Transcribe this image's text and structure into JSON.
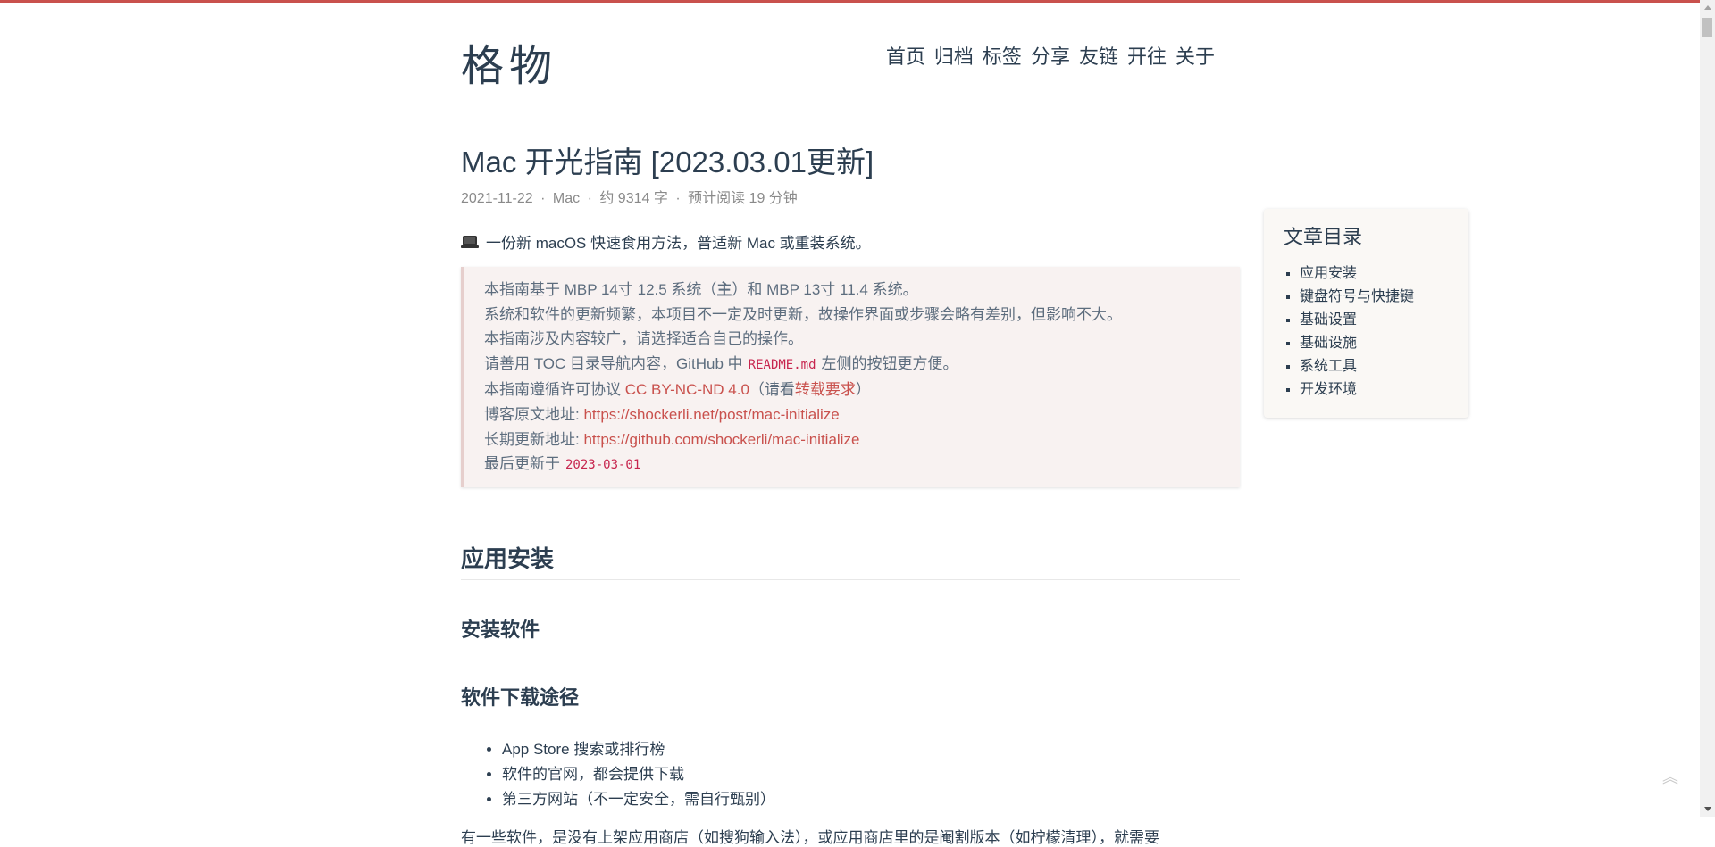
{
  "site": {
    "logo": "格物",
    "nav": [
      "首页",
      "归档",
      "标签",
      "分享",
      "友链",
      "开往",
      "关于"
    ]
  },
  "post": {
    "title": "Mac 开光指南 [2023.03.01更新]",
    "meta": {
      "date": "2021-11-22",
      "category": "Mac",
      "words": "约 9314 字",
      "reading": "预计阅读 19 分钟",
      "separator": "·"
    },
    "intro": "一份新 macOS 快速食用方法，普适新 Mac 或重装系统。",
    "quote": {
      "l1_a": "本指南基于 MBP 14寸 12.5 系统（",
      "l1_b": "主",
      "l1_c": "）和 MBP 13寸 11.4 系统。",
      "l2": "系统和软件的更新频繁，本项目不一定及时更新，故操作界面或步骤会略有差别，但影响不大。",
      "l3": "本指南涉及内容较广，请选择适合自己的操作。",
      "l4_a": "请善用 TOC 目录导航内容，GitHub 中",
      "l4_code": "README.md",
      "l4_b": "左侧的按钮更方便。",
      "l5_a": "本指南遵循许可协议 ",
      "l5_link": "CC BY-NC-ND 4.0",
      "l5_b": "（请看",
      "l5_link2": "转载要求",
      "l5_c": "）",
      "l6_a": "博客原文地址: ",
      "l6_link": "https://shockerli.net/post/mac-initialize",
      "l7_a": "长期更新地址: ",
      "l7_link": "https://github.com/shockerli/mac-initialize",
      "l8_a": "最后更新于",
      "l8_code": "2023-03-01"
    },
    "h2": "应用安装",
    "h3_1": "安装软件",
    "h3_2": "软件下载途径",
    "download_list": [
      "App Store 搜索或排行榜",
      "软件的官网，都会提供下载",
      "第三方网站（不一定安全，需自行甄别）"
    ],
    "cut_text": "有一些软件，是没有上架应用商店（如搜狗输入法），或应用商店里的是阉割版本（如柠檬清理），就需要"
  },
  "toc": {
    "title": "文章目录",
    "items": [
      "应用安装",
      "键盘符号与快捷键",
      "基础设置",
      "基础设施",
      "系统工具",
      "开发环境"
    ]
  },
  "icons": {
    "laptop": "laptop-icon",
    "back_to_top": "double-chevron-up-icon"
  },
  "colors": {
    "accent": "#c9514d",
    "text": "#2c3e50",
    "quote_bg": "#f8f2f1"
  }
}
